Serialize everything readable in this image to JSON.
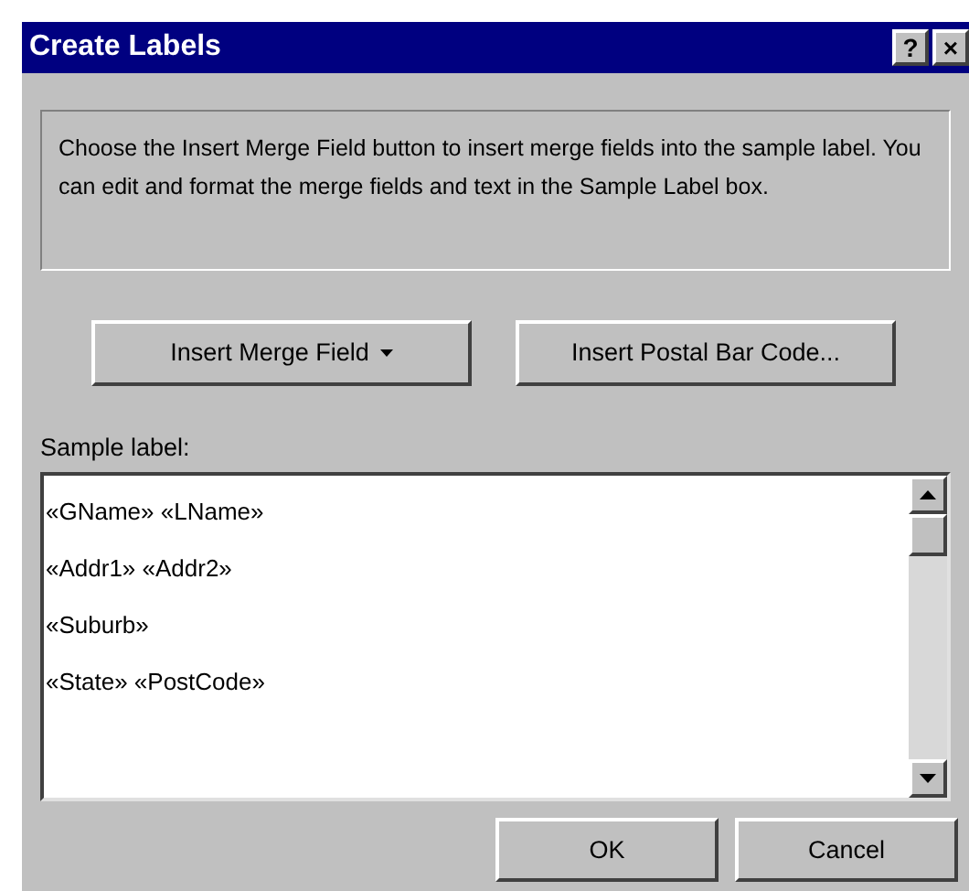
{
  "window": {
    "title": "Create Labels",
    "title_buttons": [
      "?",
      "×"
    ]
  },
  "instructions": "Choose the Insert Merge Field button to insert merge fields into the sample label.  You can edit and format the merge fields and text in the Sample Label box.",
  "action_buttons": [
    {
      "label": "Insert Merge Field",
      "dropdown": true
    },
    {
      "label": "Insert Postal Bar Code...",
      "dropdown": false
    }
  ],
  "sample_label": {
    "label": "Sample label:",
    "lines": [
      "«GName» «LName»",
      "«Addr1» «Addr2»",
      "«Suburb»",
      "«State» «PostCode»"
    ]
  },
  "buttons": [
    "OK",
    "Cancel"
  ]
}
